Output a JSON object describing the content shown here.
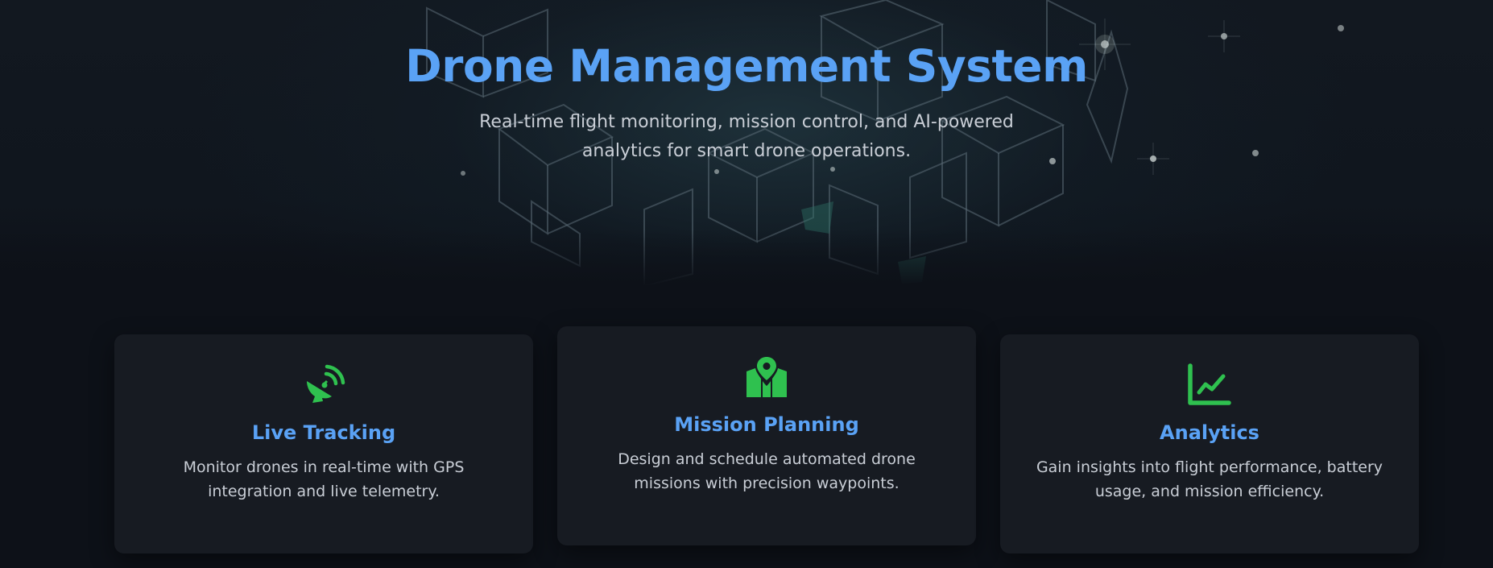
{
  "hero": {
    "title": "Drone Management System",
    "subtitle": "Real-time flight monitoring, mission control, and AI-powered analytics for smart drone operations."
  },
  "features": [
    {
      "icon": "satellite-dish-icon",
      "title": "Live Tracking",
      "description": "Monitor drones in real-time with GPS integration and live telemetry."
    },
    {
      "icon": "map-location-icon",
      "title": "Mission Planning",
      "description": "Design and schedule automated drone missions with precision waypoints."
    },
    {
      "icon": "line-chart-icon",
      "title": "Analytics",
      "description": "Gain insights into flight performance, battery usage, and mission efficiency."
    }
  ],
  "colors": {
    "background": "#0d1118",
    "card": "#171b22",
    "accent_blue": "#5aa2f5",
    "icon_green": "#2fc14f",
    "text": "#c9ced6"
  }
}
